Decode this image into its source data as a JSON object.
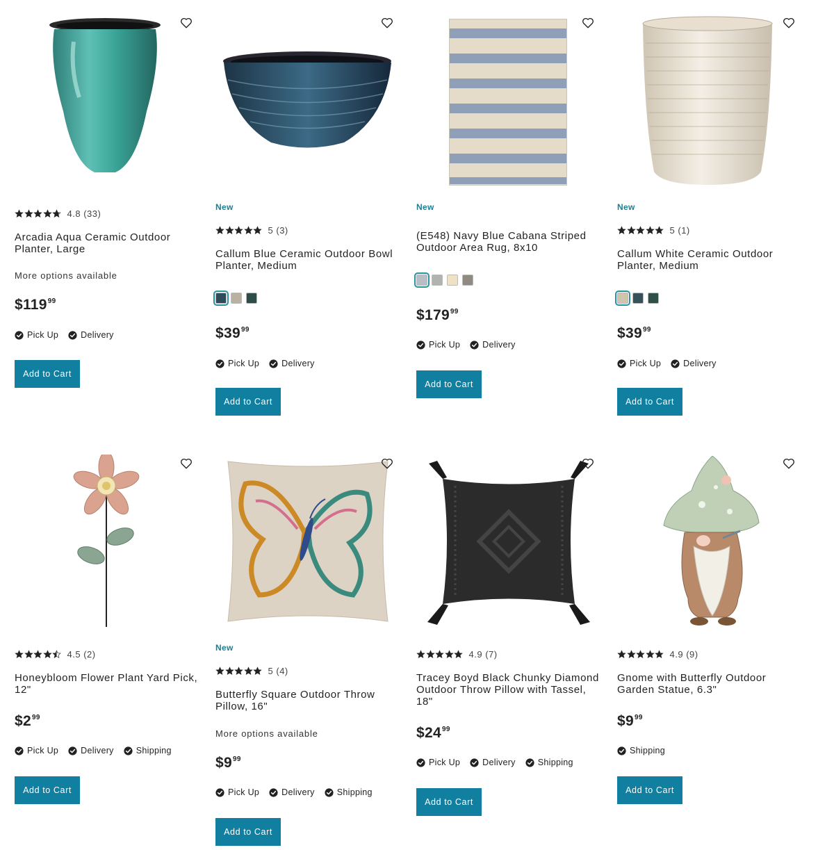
{
  "products": [
    {
      "badge": "",
      "rating_value": "4.8",
      "rating_count": "(33)",
      "rating_stars": 4.8,
      "title": "Arcadia Aqua Ceramic Outdoor Planter, Large",
      "more_options": "More options available",
      "swatches": [],
      "price_dollars": "$119",
      "price_cents": "99",
      "fulfillment": [
        "Pick Up",
        "Delivery"
      ],
      "cta": "Add to Cart",
      "image_icon": "aqua-planter"
    },
    {
      "badge": "New",
      "rating_value": "5",
      "rating_count": "(3)",
      "rating_stars": 5,
      "title": "Callum Blue Ceramic Outdoor Bowl Planter, Medium",
      "more_options": "",
      "swatches": [
        "#2f4c5c",
        "#b9b2a3",
        "#2e4d48"
      ],
      "price_dollars": "$39",
      "price_cents": "99",
      "fulfillment": [
        "Pick Up",
        "Delivery"
      ],
      "cta": "Add to Cart",
      "image_icon": "blue-bowl-planter"
    },
    {
      "badge": "New",
      "rating_value": "",
      "rating_count": "",
      "rating_stars": 0,
      "title": "(E548) Navy Blue Cabana Striped Outdoor Area Rug, 8x10",
      "more_options": "",
      "swatches": [
        "#b7bec6",
        "#b0b3b0",
        "#efe1c3",
        "#8f8b83"
      ],
      "price_dollars": "$179",
      "price_cents": "99",
      "fulfillment": [
        "Pick Up",
        "Delivery"
      ],
      "cta": "Add to Cart",
      "image_icon": "striped-rug"
    },
    {
      "badge": "New",
      "rating_value": "5",
      "rating_count": "(1)",
      "rating_stars": 5,
      "title": "Callum White Ceramic Outdoor Planter, Medium",
      "more_options": "",
      "swatches": [
        "#cfc4ae",
        "#36515a",
        "#2f4f48"
      ],
      "price_dollars": "$39",
      "price_cents": "99",
      "fulfillment": [
        "Pick Up",
        "Delivery"
      ],
      "cta": "Add to Cart",
      "image_icon": "white-planter"
    },
    {
      "badge": "",
      "rating_value": "4.5",
      "rating_count": "(2)",
      "rating_stars": 4.5,
      "title": "Honeybloom Flower Plant Yard Pick, 12\"",
      "more_options": "",
      "swatches": [],
      "price_dollars": "$2",
      "price_cents": "99",
      "fulfillment": [
        "Pick Up",
        "Delivery",
        "Shipping"
      ],
      "cta": "Add to Cart",
      "image_icon": "flower-yard-pick"
    },
    {
      "badge": "New",
      "rating_value": "5",
      "rating_count": "(4)",
      "rating_stars": 5,
      "title": "Butterfly Square Outdoor Throw Pillow, 16\"",
      "more_options": "More options available",
      "swatches": [],
      "price_dollars": "$9",
      "price_cents": "99",
      "fulfillment": [
        "Pick Up",
        "Delivery",
        "Shipping"
      ],
      "cta": "Add to Cart",
      "image_icon": "butterfly-pillow"
    },
    {
      "badge": "",
      "rating_value": "4.9",
      "rating_count": "(7)",
      "rating_stars": 4.9,
      "title": "Tracey Boyd Black Chunky Diamond Outdoor Throw Pillow with Tassel, 18\"",
      "more_options": "",
      "swatches": [],
      "price_dollars": "$24",
      "price_cents": "99",
      "fulfillment": [
        "Pick Up",
        "Delivery",
        "Shipping"
      ],
      "cta": "Add to Cart",
      "image_icon": "black-tassel-pillow"
    },
    {
      "badge": "",
      "rating_value": "4.9",
      "rating_count": "(9)",
      "rating_stars": 4.9,
      "title": "Gnome with Butterfly Outdoor Garden Statue, 6.3\"",
      "more_options": "",
      "swatches": [],
      "price_dollars": "$9",
      "price_cents": "99",
      "fulfillment": [
        "Shipping"
      ],
      "cta": "Add to Cart",
      "image_icon": "gnome-statue"
    }
  ],
  "colors": {
    "accent": "#107fa0",
    "badge_new": "#1a7f92",
    "star": "#222222"
  }
}
